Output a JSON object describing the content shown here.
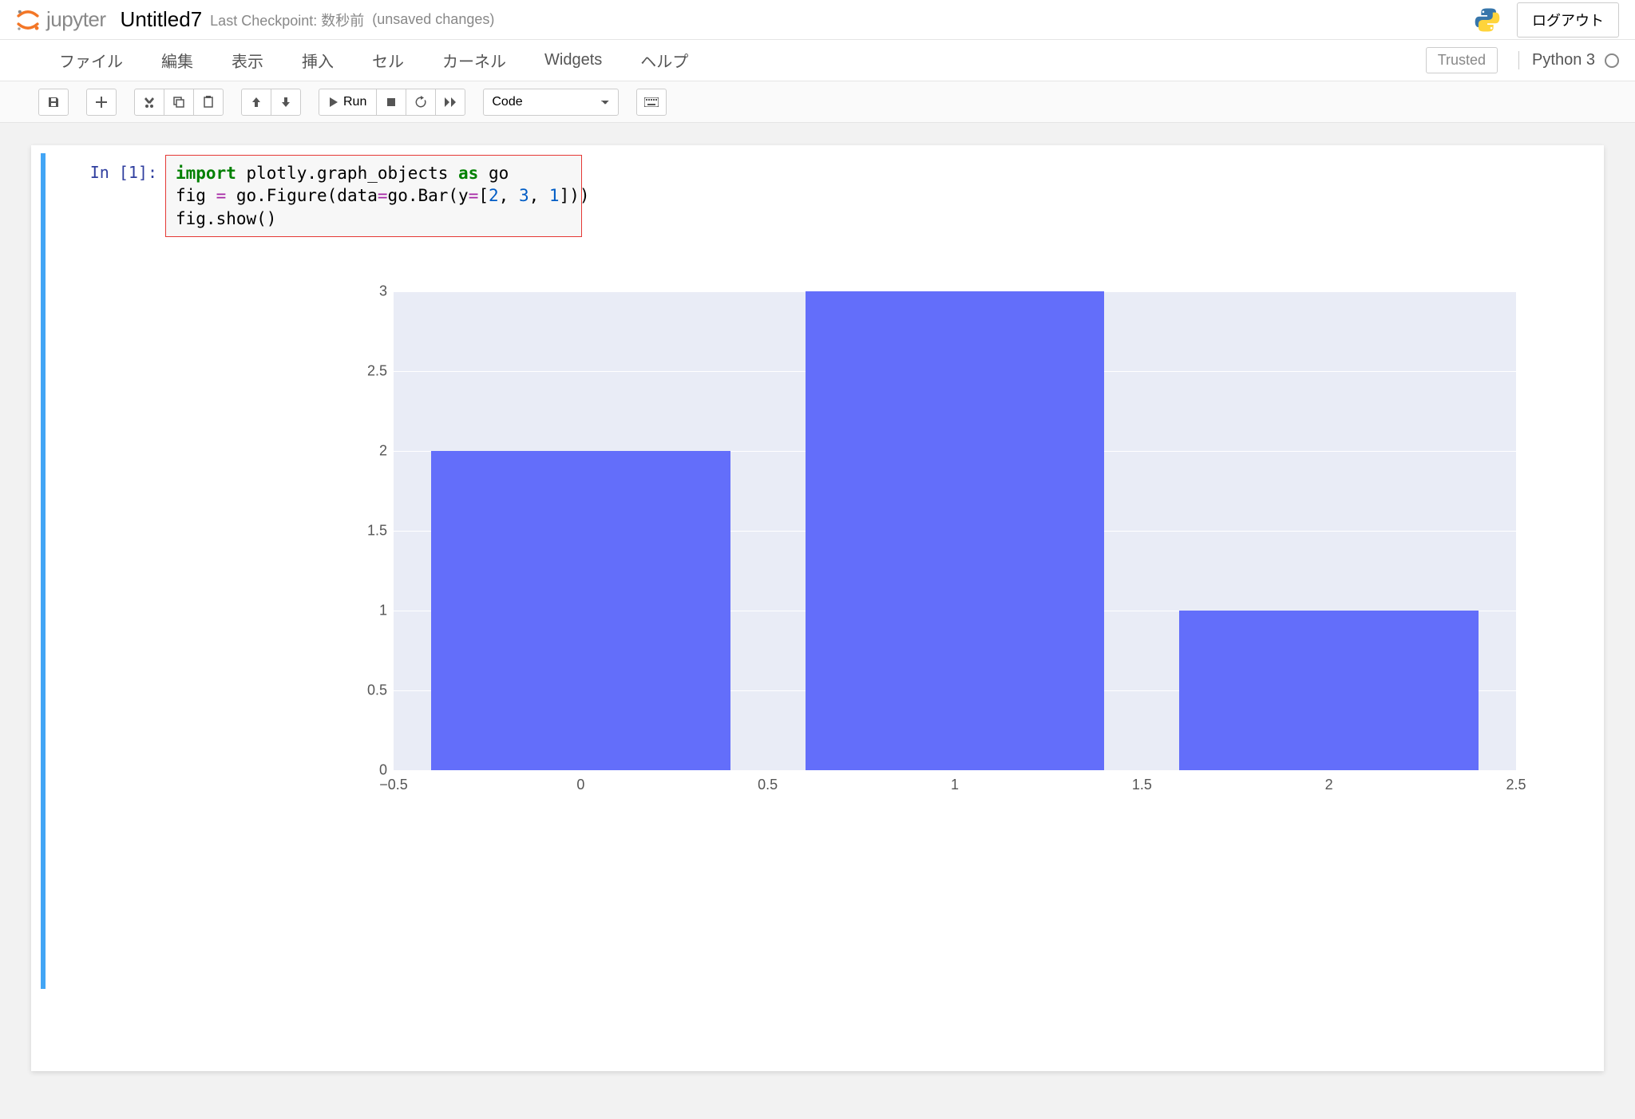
{
  "header": {
    "logo_text": "jupyter",
    "title": "Untitled7",
    "checkpoint_label": "Last Checkpoint: 数秒前",
    "unsaved_label": "(unsaved changes)",
    "logout_label": "ログアウト"
  },
  "menu": {
    "items": [
      "ファイル",
      "編集",
      "表示",
      "挿入",
      "セル",
      "カーネル",
      "Widgets",
      "ヘルプ"
    ],
    "trusted_label": "Trusted",
    "kernel_label": "Python 3"
  },
  "toolbar": {
    "run_label": "Run",
    "cell_type": "Code"
  },
  "cell": {
    "prompt": "In [1]:",
    "code_lines": [
      "import plotly.graph_objects as go",
      "fig = go.Figure(data=go.Bar(y=[2, 3, 1]))",
      "fig.show()"
    ]
  },
  "chart_data": {
    "type": "bar",
    "x": [
      0,
      1,
      2
    ],
    "values": [
      2,
      3,
      1
    ],
    "y_ticks": [
      0,
      0.5,
      1,
      1.5,
      2,
      2.5,
      3
    ],
    "x_ticks": [
      -0.5,
      0,
      0.5,
      1,
      1.5,
      2,
      2.5
    ],
    "x_range": [
      -0.5,
      2.5
    ],
    "y_range": [
      0,
      3
    ],
    "bar_color": "#636efa",
    "plot_bg": "#e9ecf6"
  }
}
